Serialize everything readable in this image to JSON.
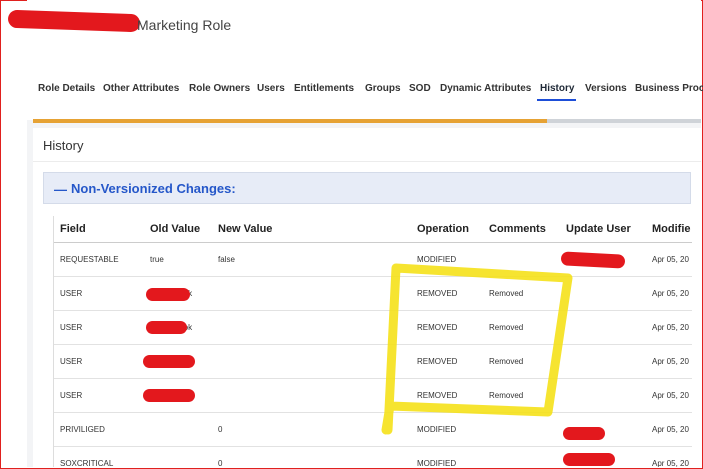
{
  "header": {
    "title": "Marketing Role"
  },
  "tabs": [
    {
      "label": "Role Details"
    },
    {
      "label": "Other Attributes"
    },
    {
      "label": "Role Owners"
    },
    {
      "label": "Users"
    },
    {
      "label": "Entitlements"
    },
    {
      "label": "Groups"
    },
    {
      "label": "SOD"
    },
    {
      "label": "Dynamic Attributes"
    },
    {
      "label": "History",
      "active": true
    },
    {
      "label": "Versions"
    },
    {
      "label": "Business Proce"
    }
  ],
  "progress": {
    "fraction": 0.77,
    "fill_color": "#e6a234",
    "track_color": "#cfd3d8"
  },
  "main": {
    "heading": "History",
    "section": {
      "toggle_icon": "minus-icon",
      "toggle_glyph": "—",
      "title": "Non-Versionized Changes:"
    }
  },
  "table": {
    "columns": [
      "Field",
      "Old Value",
      "New Value",
      "Operation",
      "Comments",
      "Update User",
      "Modifie"
    ],
    "rows": [
      {
        "field": "REQUESTABLE",
        "old": "true",
        "new": "false",
        "op": "MODIFIED",
        "comments": "",
        "user": "",
        "modified": "Apr 05, 20"
      },
      {
        "field": "USER",
        "old": "mok",
        "new": "",
        "op": "REMOVED",
        "comments": "Removed",
        "user": "",
        "modified": "Apr 05, 20"
      },
      {
        "field": "USER",
        "old": "mok",
        "new": "",
        "op": "REMOVED",
        "comments": "Removed",
        "user": "",
        "modified": "Apr 05, 20"
      },
      {
        "field": "USER",
        "old": "",
        "new": "",
        "op": "REMOVED",
        "comments": "Removed",
        "user": "",
        "modified": "Apr 05, 20"
      },
      {
        "field": "USER",
        "old": "",
        "new": "",
        "op": "REMOVED",
        "comments": "Removed",
        "user": "",
        "modified": "Apr 05, 20"
      },
      {
        "field": "PRIVILIGED",
        "old": "",
        "new": "0",
        "op": "MODIFIED",
        "comments": "",
        "user": "",
        "modified": "Apr 05, 20"
      },
      {
        "field": "SOXCRITICAL",
        "old": "",
        "new": "0",
        "op": "MODIFIED",
        "comments": "",
        "user": "",
        "modified": "Apr 05, 20"
      }
    ]
  },
  "colors": {
    "accent": "#2557c9",
    "redaction": "#e3181d",
    "highlight": "#f5e11a",
    "frame": "#e0201e"
  }
}
